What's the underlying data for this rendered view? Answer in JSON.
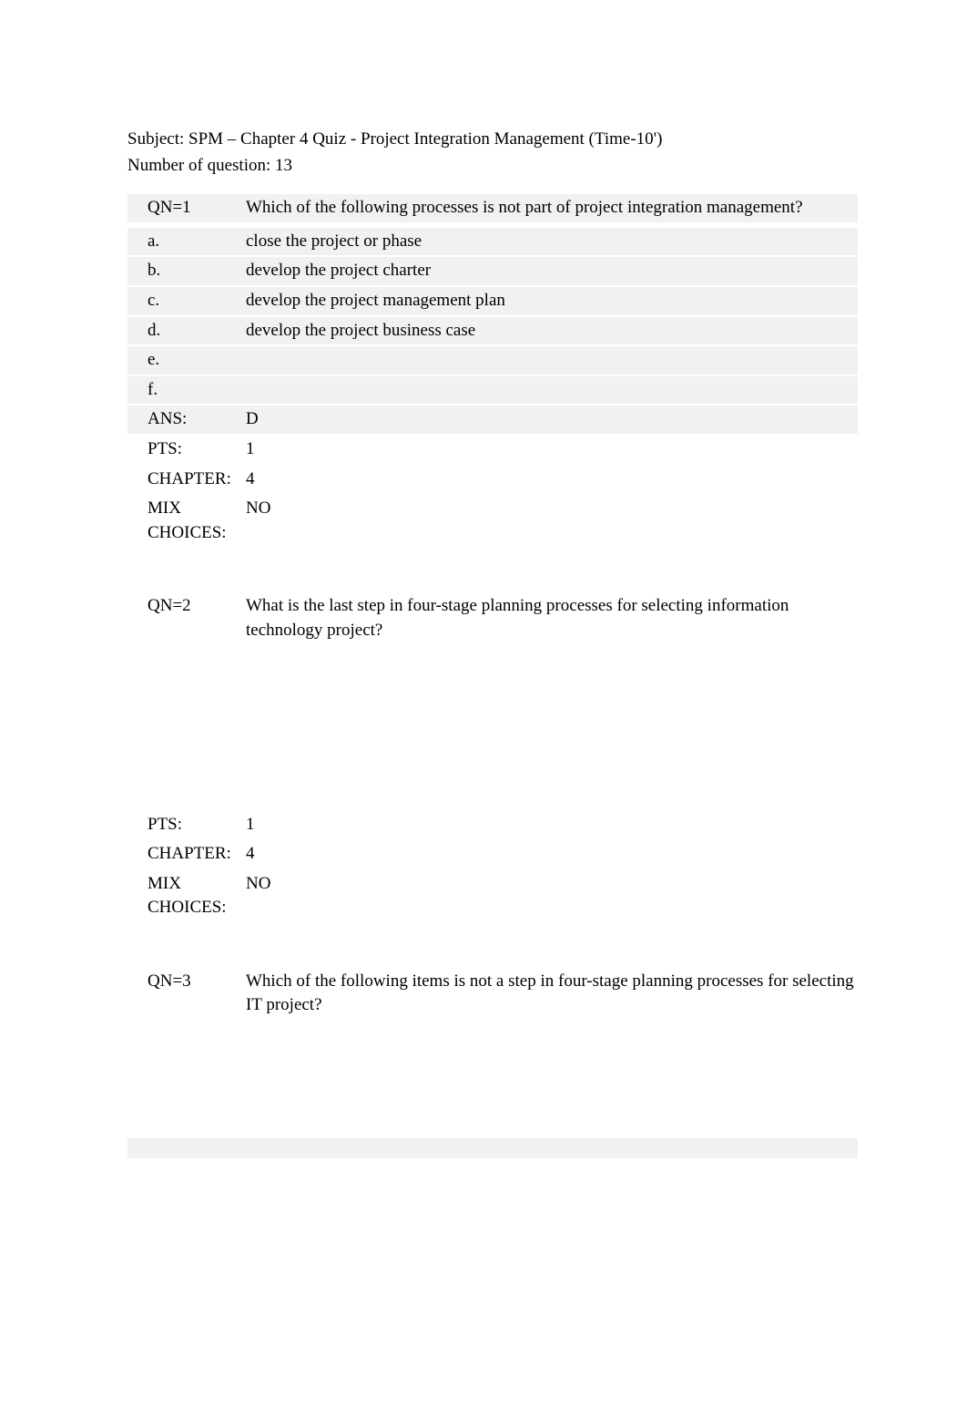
{
  "header": {
    "subject_line": "Subject: SPM – Chapter 4 Quiz - Project Integration Management (Time-10')",
    "number_line": "Number of question: 13"
  },
  "q1": {
    "qn_label": "QN=1",
    "question": "Which of the following processes is not part of project integration management?",
    "a_label": "a.",
    "a_text": "close the project or phase",
    "b_label": "b.",
    "b_text": "develop the project charter",
    "c_label": "c.",
    "c_text": "develop the project management plan",
    "d_label": "d.",
    "d_text": "develop the project business case",
    "e_label": "e.",
    "e_text": "",
    "f_label": "f.",
    "f_text": "",
    "ans_label": "ANS:",
    "ans_value": "D",
    "pts_label": "PTS:",
    "pts_value": "1",
    "chapter_label": "CHAPTER:",
    "chapter_value": "4",
    "mix_label": "MIX CHOICES:",
    "mix_value": "NO"
  },
  "q2": {
    "qn_label": "QN=2",
    "question": "What is the last step in four-stage planning processes for selecting information technology project?",
    "pts_label": "PTS:",
    "pts_value": "1",
    "chapter_label": "CHAPTER:",
    "chapter_value": "4",
    "mix_label": "MIX CHOICES:",
    "mix_value": "NO"
  },
  "q3": {
    "qn_label": "QN=3",
    "question": "Which of the following items is not a step in four-stage planning processes for selecting IT project?"
  }
}
